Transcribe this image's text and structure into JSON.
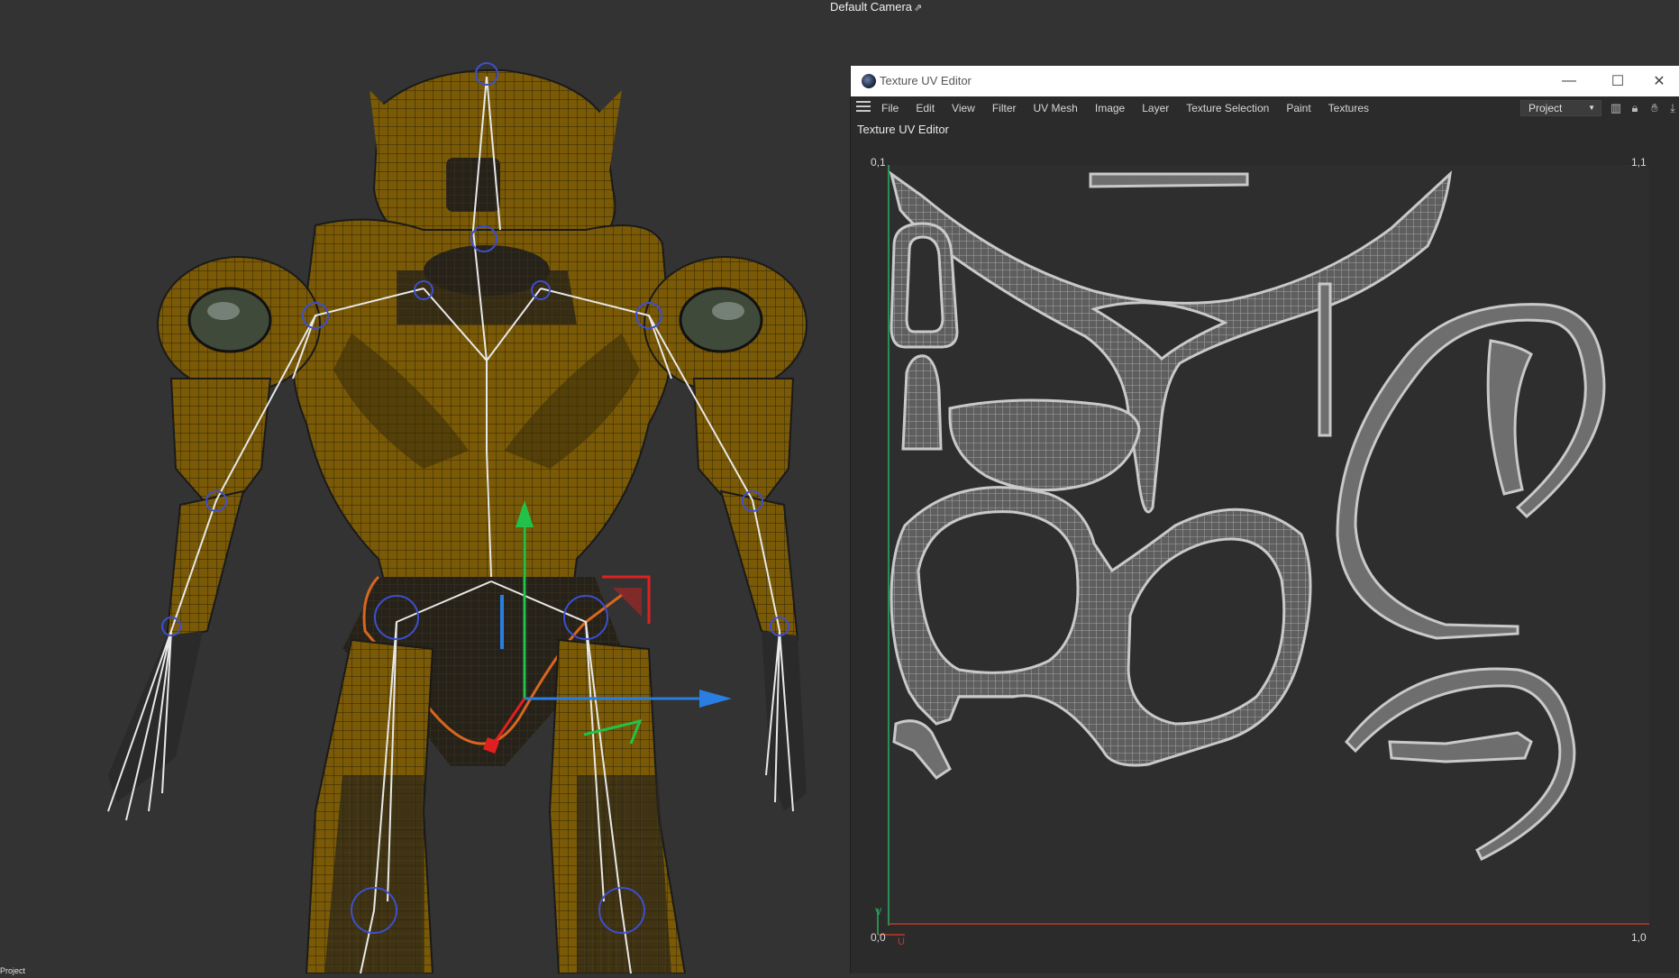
{
  "viewport": {
    "camera_label": "Default Camera",
    "camera_icon": "camera-link-icon",
    "bottom_label": "Project",
    "colors": {
      "background": "#333333",
      "armor": "#7a5a06",
      "armor_dark": "#2a2410",
      "rig": "#e8e8e8",
      "joint": "#3d4fd0",
      "axis_x": "#2a7de1",
      "axis_y": "#22c24a",
      "axis_z": "#e02020",
      "selection": "#d9661f"
    }
  },
  "uv_editor": {
    "window_title": "Texture UV Editor",
    "app_icon": "cinema4d-logo-icon",
    "window_buttons": [
      "minimize-icon",
      "maximize-icon",
      "close-icon"
    ],
    "menu": [
      "File",
      "Edit",
      "View",
      "Filter",
      "UV Mesh",
      "Image",
      "Layer",
      "Texture Selection",
      "Paint",
      "Textures"
    ],
    "project_select": "Project",
    "toolbar_icons": [
      "histogram-icon",
      "lock-icon",
      "hand-icon",
      "pin-icon"
    ],
    "subheader": "Texture UV Editor",
    "corners": {
      "top_left": "0,1",
      "top_right": "1,1",
      "bottom_left": "0,0",
      "bottom_right": "1,0"
    },
    "axis_labels": {
      "u": "U",
      "v": "V"
    },
    "colors": {
      "canvas": "#2e2e2e",
      "island_fill": "#6e6e6e",
      "island_line": "#c9c9c9",
      "u_axis": "#c0392b",
      "v_axis": "#27ae60"
    }
  }
}
